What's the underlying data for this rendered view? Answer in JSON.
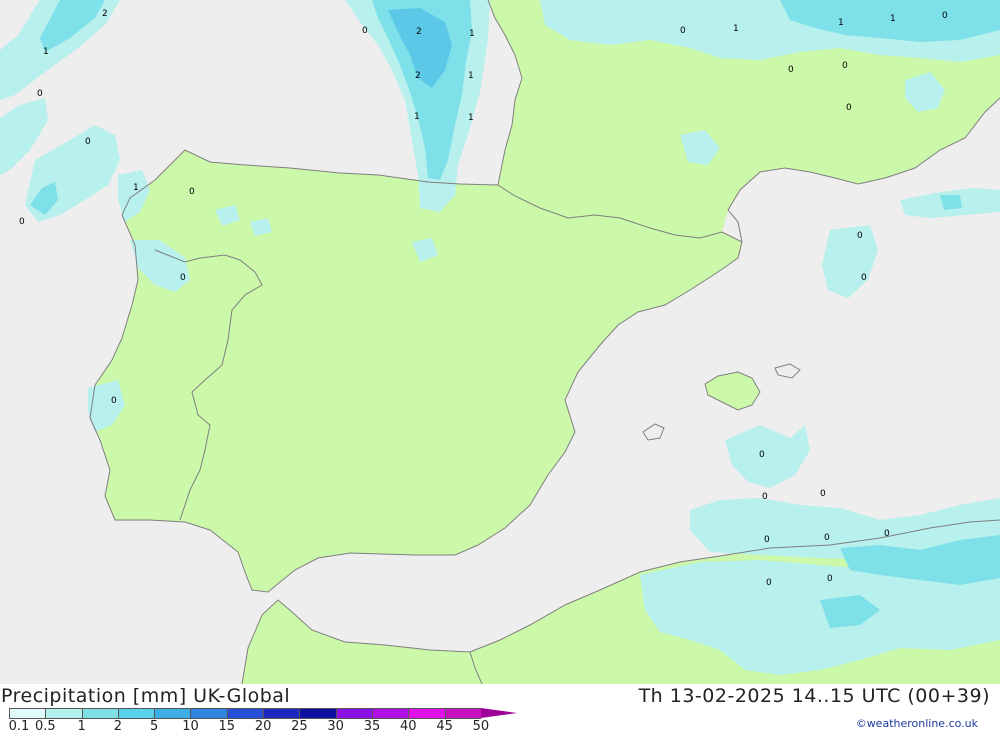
{
  "title_left": "Precipitation [mm] UK-Global",
  "title_right": "Th 13-02-2025 14..15 UTC (00+39)",
  "credit": "©weatheronline.co.uk",
  "colors": {
    "sea": "#eeeeee",
    "land": "#ccf9a9",
    "border": "#7f7f7f",
    "precip_light": "#b7f0ec",
    "precip_mid": "#7ee0e8",
    "precip_heavy": "#5cc8e8"
  },
  "legend": {
    "labels": [
      "0.1",
      "0.5",
      "1",
      "2",
      "5",
      "10",
      "15",
      "20",
      "25",
      "30",
      "35",
      "40",
      "45",
      "50"
    ],
    "colors": [
      "#e0fafa",
      "#b4f0ee",
      "#7ee0e4",
      "#57d2e8",
      "#3eaee6",
      "#2f84e0",
      "#2650d8",
      "#1c28c0",
      "#1010a0",
      "#8a10e6",
      "#b010e6",
      "#e010ea",
      "#c810c0"
    ]
  },
  "map_labels": [
    "2",
    "1",
    "0",
    "0",
    "0",
    "1",
    "0",
    "0",
    "0",
    "2",
    "1",
    "2",
    "1",
    "1",
    "1",
    "0",
    "1",
    "1",
    "1",
    "0",
    "0",
    "0",
    "0",
    "0",
    "0",
    "0",
    "0",
    "0",
    "0",
    "0",
    "0",
    "0",
    "0",
    "0"
  ]
}
